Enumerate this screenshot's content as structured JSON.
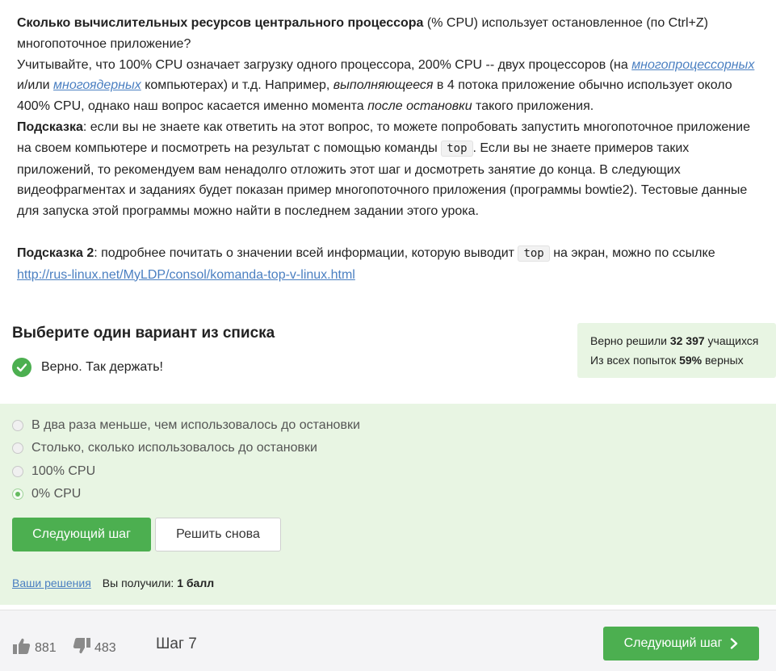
{
  "question": {
    "p1_bold": "Сколько вычислительных ресурсов центрального процессора",
    "p1_rest": " (% CPU) использует остановленное (по Ctrl+Z) многопоточное приложение?",
    "p2_a": "Учитывайте, что 100% CPU означает загрузку одного процессора, 200% CPU -- двух процессоров (на ",
    "p2_link1": "многопроцессорных",
    "p2_b": " и/или ",
    "p2_link2": "многоядерных",
    "p2_c": " компьютерах) и т.д. Например, ",
    "p2_i1": "выполняющееся",
    "p2_d": " в 4 потока приложение обычно использует около 400% CPU, однако наш вопрос касается именно момента ",
    "p2_i2": "после остановки",
    "p2_e": " такого приложения.",
    "hint1_label": "Подсказка",
    "hint1_a": ": если вы не знаете как ответить на этот вопрос, то можете попробовать запустить многопоточное приложение на своем компьютере и посмотреть на результат с помощью команды ",
    "hint1_code": "top",
    "hint1_b": ". Если вы не знаете примеров таких приложений, то рекомендуем вам ненадолго отложить этот шаг и досмотреть занятие до конца. В следующих видеофрагментах и заданиях будет показан пример многопоточного приложения (программы bowtie2). Тестовые данные для запуска этой программы можно найти в последнем задании этого урока.",
    "hint2_label": "Подсказка 2",
    "hint2_a": ": подробнее почитать о значении всей информации, которую выводит ",
    "hint2_code": "top",
    "hint2_b": " на экран, можно по ссылке",
    "hint2_link": "http://rus-linux.net/MyLDP/consol/komanda-top-v-linux.html"
  },
  "quiz": {
    "title": "Выберите один вариант из списка",
    "feedback": "Верно. Так держать!",
    "stats": {
      "solved_prefix": "Верно решили ",
      "solved_count": "32 397",
      "solved_suffix": " учащихся",
      "attempts_prefix": "Из всех попыток ",
      "attempts_percent": "59%",
      "attempts_suffix": " верных"
    },
    "options": [
      {
        "label": "В два раза меньше, чем использовалось до остановки",
        "checked": false
      },
      {
        "label": "Столько, сколько использовалось до остановки",
        "checked": false
      },
      {
        "label": "100% CPU",
        "checked": false
      },
      {
        "label": "0% CPU",
        "checked": true
      }
    ],
    "next_button": "Следующий шаг",
    "retry_button": "Решить снова",
    "solutions_link": "Ваши решения",
    "score_prefix": "Вы получили: ",
    "score_value": "1 балл"
  },
  "footer": {
    "likes": "881",
    "dislikes": "483",
    "step": "Шаг 7",
    "next_button": "Следующий шаг"
  },
  "colors": {
    "accent_green": "#4caf50",
    "light_green_bg": "#e8f5e3",
    "link_blue": "#4a7fc1"
  }
}
